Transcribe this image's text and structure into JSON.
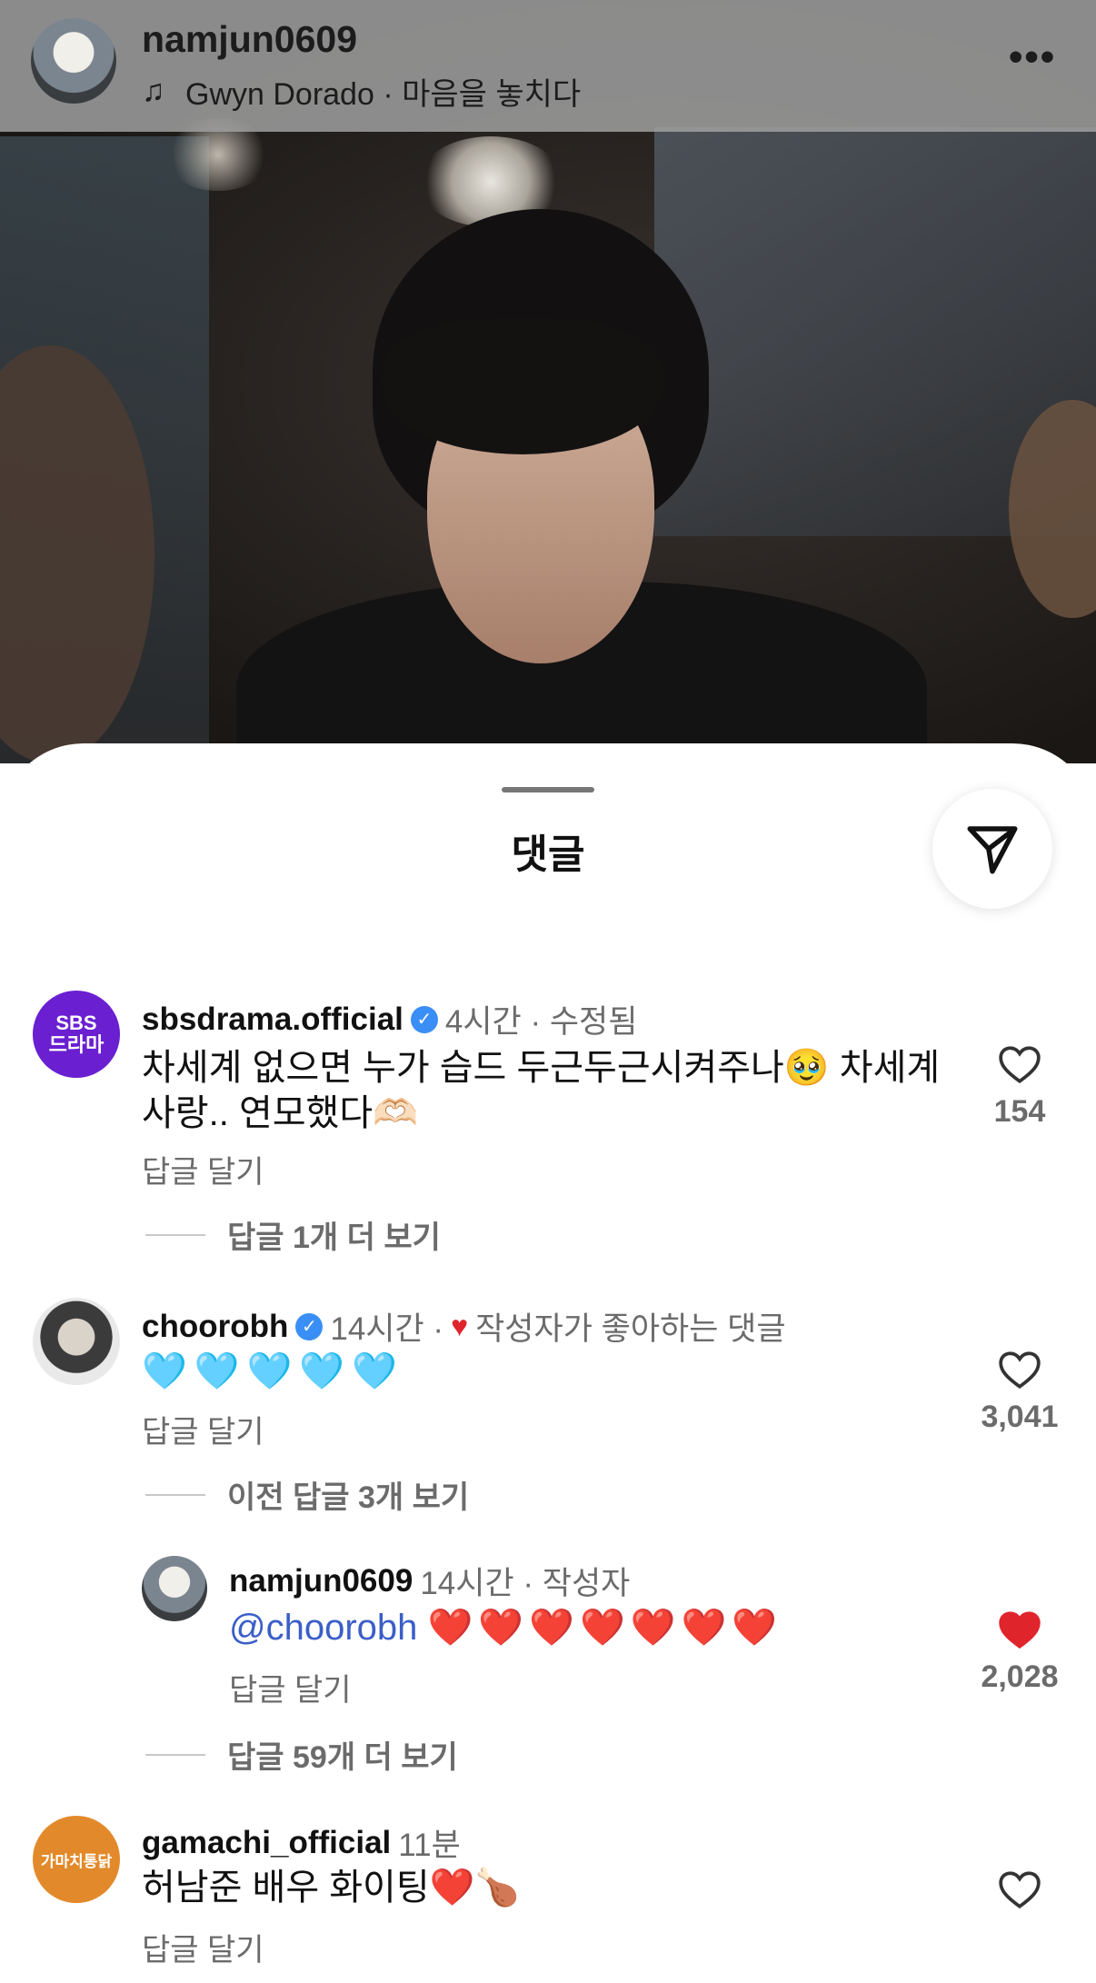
{
  "post": {
    "username": "namjun0609",
    "music": "Gwyn Dorado · 마음을 놓치다",
    "more_label": "•••"
  },
  "sheet": {
    "title": "댓글"
  },
  "comments": [
    {
      "username": "sbsdrama.official",
      "verified": true,
      "meta": "4시간 · 수정됨",
      "text_line1": "차세계 없으면 누가 습드 두근두근시켜주나🥹 차세계",
      "text_line2": "사랑.. 연모했다🫶🏻",
      "reply_label": "답글 달기",
      "likes": "154",
      "more_replies": "답글 1개 더 보기",
      "avatar_text": "SBS 드라마"
    },
    {
      "username": "choorobh",
      "verified": true,
      "meta": "14시간 ·",
      "creator_liked": "작성자가 좋아하는 댓글",
      "text": "🩵🩵🩵🩵🩵",
      "reply_label": "답글 달기",
      "likes": "3,041",
      "more_replies": "이전 답글 3개 보기"
    },
    {
      "username": "namjun0609",
      "meta": "14시간 · 작성자",
      "mention": "@choorobh",
      "text": "❤️❤️❤️❤️❤️❤️❤️",
      "reply_label": "답글 달기",
      "likes": "2,028",
      "more_replies": "답글 59개 더 보기"
    },
    {
      "username": "gamachi_official",
      "meta": "11분",
      "text": "허남준 배우 화이팅❤️🍗",
      "reply_label": "답글 달기",
      "avatar_text": "가마치통닭"
    }
  ],
  "colors": {
    "verified": "#3a8ff6",
    "liked_heart": "#e0242c",
    "sbs_purple": "#6a1fd1",
    "gamachi_orange": "#e28a2b"
  }
}
